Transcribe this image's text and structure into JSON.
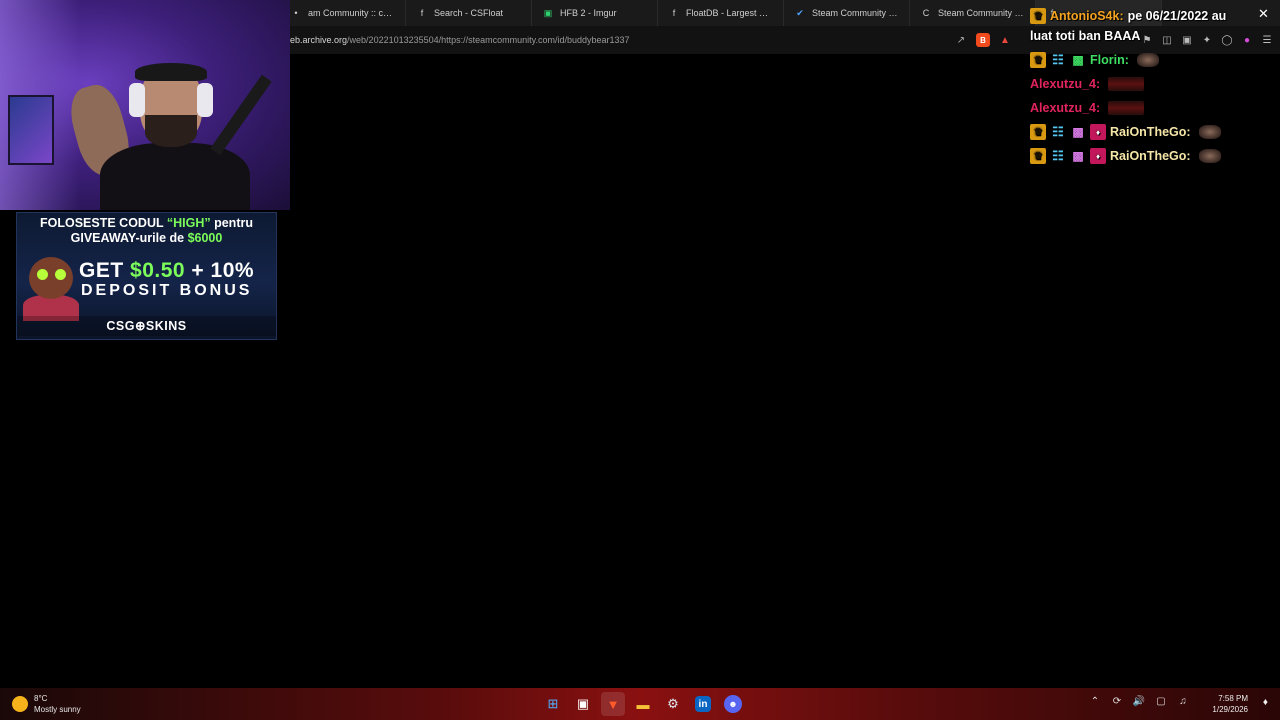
{
  "browser": {
    "tabs": [
      {
        "label": "am Community :: case",
        "icon": "steam-tab-icon",
        "glyph": "•"
      },
      {
        "label": "Search - CSFloat",
        "icon": "csfloat-tab-icon",
        "glyph": "f"
      },
      {
        "label": "HFB 2 - Imgur",
        "icon": "imgur-tab-icon",
        "glyph": "▣"
      },
      {
        "label": "FloatDB - Largest Databas",
        "icon": "floatdb-tab-icon",
        "glyph": "f"
      },
      {
        "label": "Steam Community :: case",
        "icon": "steam-check-tab-icon",
        "glyph": "✔"
      },
      {
        "label": "Steam Community :: Booth",
        "icon": "steam-c-tab-icon",
        "glyph": "C"
      },
      {
        "label": "",
        "icon": "active-tab-icon",
        "glyph": "f"
      }
    ],
    "url_prefix": "eb.archive.org",
    "url_rest": "/web/20221013235504/https://steamcommunity.com/id/buddybear1337"
  },
  "ad": {
    "line1_a": "FOLOSESTE CODUL ",
    "line1_code": "“HIGH”",
    "line1_b": " pentru",
    "line2_a": "GIVEAWAY-urile de ",
    "line2_amount": "$6000",
    "get_a": "GET ",
    "get_amount": "$0.50",
    "get_b": " + 10%",
    "deposit": "DEPOSIT BONUS",
    "brand": "CSG⊕SKINS"
  },
  "chat": {
    "messages": [
      {
        "user": "AntonioS4k:",
        "text": "pe 06/21/2022 au",
        "color": "#f4a321"
      },
      {
        "user": "",
        "text": "luat toti ban BAAA",
        "color": "#ffffff"
      },
      {
        "user": "Florin:",
        "text": "",
        "color": "#3ddc62"
      },
      {
        "user": "Alexutzu_4:",
        "text": "",
        "color": "#e0245e"
      },
      {
        "user": "Alexutzu_4:",
        "text": "",
        "color": "#e0245e"
      },
      {
        "user": "RaiOnTheGo:",
        "text": "",
        "color": "#f5e6a8"
      },
      {
        "user": "RaiOnTheGo:",
        "text": "",
        "color": "#f5e6a8"
      }
    ],
    "close_glyph": "✕"
  },
  "taskbar": {
    "weather_temp": "8°C",
    "weather_desc": "Mostly sunny",
    "time": "7:58 PM",
    "date": "1/29/2026"
  }
}
